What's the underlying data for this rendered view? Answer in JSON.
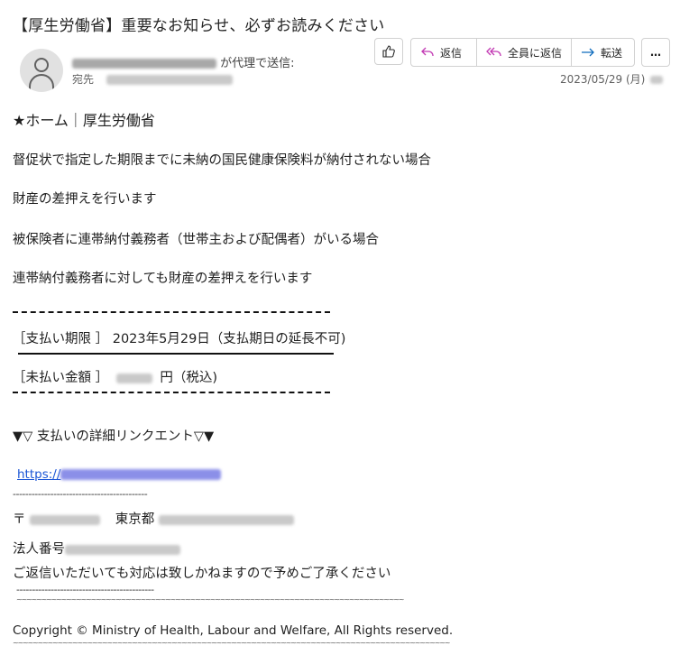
{
  "email": {
    "subject": "【厚生労働省】重要なお知らせ、必ずお読みください",
    "sender_suffix": "が代理で送信:",
    "to_label": "宛先",
    "date": "2023/05/29 (月)",
    "actions": {
      "like_icon": "thumbs-up-icon",
      "reply": "返信",
      "reply_all": "全員に返信",
      "forward": "転送",
      "more": "…"
    }
  },
  "body": {
    "header": "★ホーム｜厚生労働省",
    "para1": "督促状で指定した期限までに未納の国民健康保険料が納付されない場合",
    "para2": "財産の差押えを行います",
    "para3": "被保険者に連帯納付義務者（世帯主および配偶者）がいる場合",
    "para4": "連帯納付義務者に対しても財産の差押えを行います",
    "deadline": "［支払い期限 ］ 2023年5月29日（支払期日の延長不可)",
    "amount_label": "［未払い金額 ］",
    "amount_suffix": "円（税込)",
    "link_heading": "▼▽ 支払いの詳細リンクエント▽▼",
    "link_prefix": "https://",
    "separator": "-------------------------------------------",
    "postal_mark": "〒",
    "city": "東京都",
    "corp_number_label": "法人番号",
    "no_reply_note": "ご返信いただいても対応は致しかねますので予めご了承ください",
    "separator2": "--------------------------------------------",
    "tilde_line": "~~~~~~~~~~~~~~~~~~~~~~~~~~~~~~~~~~~~~~~~~~~~~~~~~~~~~~~~~~~~~~~~~~~~~~~~~~~~~~",
    "copyright": "Copyright © Ministry of Health, Labour and Welfare, All Rights reserved.",
    "tilde_line_bottom": "~~~~~~~~~~~~~~~~~~~~~~~~~~~~~~~~~~~~~~~~~~~~~~~~~~~~~~~~~~~~~~~~~~~~~~~~~~~~~~~~~~~~~~~~"
  },
  "colors": {
    "link": "#1a55d6",
    "reply_icon": "#c239b3",
    "forward_icon": "#0f6cbd"
  }
}
